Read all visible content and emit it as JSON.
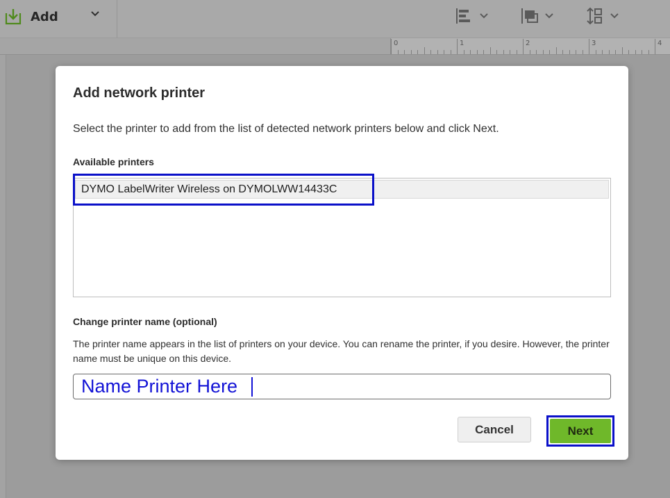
{
  "toolbar": {
    "add_label": "Add",
    "tools": [
      {
        "name": "align-icon"
      },
      {
        "name": "arrange-icon"
      },
      {
        "name": "distribute-icon"
      }
    ]
  },
  "ruler": {
    "labels": [
      "0",
      "1",
      "2",
      "3",
      "4"
    ]
  },
  "dialog": {
    "title": "Add network printer",
    "instruction": "Select the printer to add from the list of detected network printers below and click Next.",
    "available_label": "Available printers",
    "printers": [
      "DYMO LabelWriter Wireless on DYMOLWW14433C"
    ],
    "rename_label": "Change printer name (optional)",
    "rename_help": "The printer name appears in the list of printers on your device. You can rename the printer, if you desire. However, the printer name must be unique on this device.",
    "name_value": "Name Printer Here",
    "cancel_label": "Cancel",
    "next_label": "Next"
  },
  "colors": {
    "accent_green": "#6fb82a",
    "highlight_blue": "#0a10c9",
    "input_text_blue": "#1212d6"
  }
}
